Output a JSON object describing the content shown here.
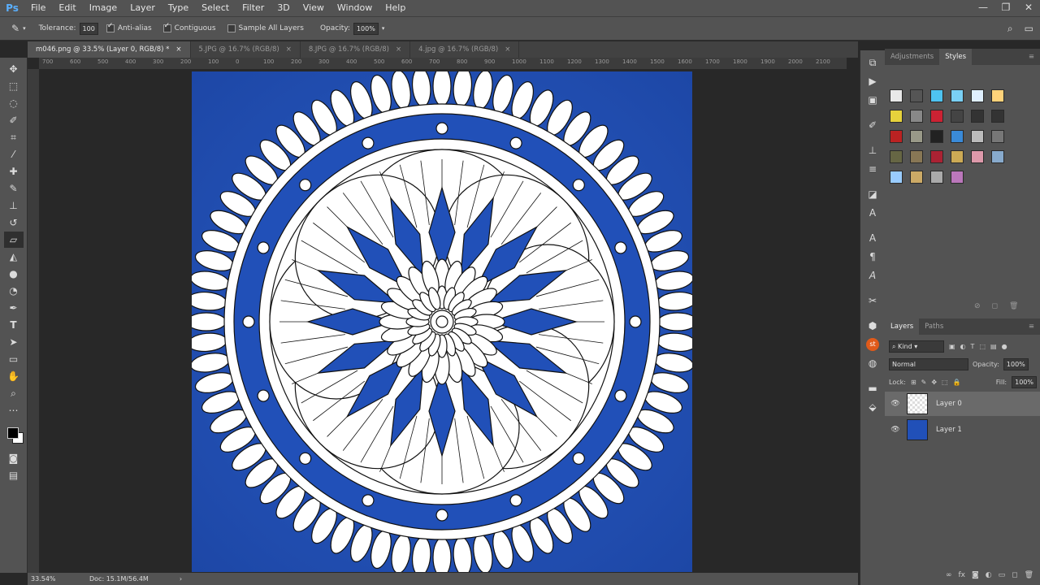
{
  "app": {
    "logo": "Ps",
    "window_controls": [
      "—",
      "❐",
      "✕"
    ]
  },
  "menu": [
    "File",
    "Edit",
    "Image",
    "Layer",
    "Type",
    "Select",
    "Filter",
    "3D",
    "View",
    "Window",
    "Help"
  ],
  "options": {
    "tolerance_label": "Tolerance:",
    "tolerance_value": "100",
    "antialias_label": "Anti-alias",
    "contiguous_label": "Contiguous",
    "sample_all_label": "Sample All Layers",
    "opacity_label": "Opacity:",
    "opacity_value": "100%"
  },
  "tabs": [
    {
      "label": "m046.png @ 33.5% (Layer 0, RGB/8) *"
    },
    {
      "label": "5.JPG @ 16.7% (RGB/8)"
    },
    {
      "label": "8.JPG @ 16.7% (RGB/8)"
    },
    {
      "label": "4.jpg @ 16.7% (RGB/8)"
    }
  ],
  "ruler": [
    "700",
    "600",
    "500",
    "400",
    "300",
    "200",
    "100",
    "0",
    "100",
    "200",
    "300",
    "400",
    "500",
    "600",
    "700",
    "800",
    "900",
    "1000",
    "1100",
    "1200",
    "1300",
    "1400",
    "1500",
    "1600",
    "1700",
    "1800",
    "1900",
    "2000",
    "2100"
  ],
  "status": {
    "zoom": "33.54%",
    "doc": "Doc: 15.1M/56.4M",
    "arrow": "›"
  },
  "panels": {
    "tab_adjustments": "Adjustments",
    "tab_styles": "Styles",
    "tab_layers": "Layers",
    "tab_paths": "Paths",
    "kind_label": "Kind",
    "blend_mode": "Normal",
    "opacity_label": "Opacity:",
    "opacity_value": "100%",
    "lock_label": "Lock:",
    "fill_label": "Fill:",
    "fill_value": "100%",
    "layers": [
      {
        "name": "Layer 0"
      },
      {
        "name": "Layer 1"
      }
    ]
  },
  "colors": {
    "canvas_blue": "#2150b8",
    "ui_gray": "#535353"
  }
}
